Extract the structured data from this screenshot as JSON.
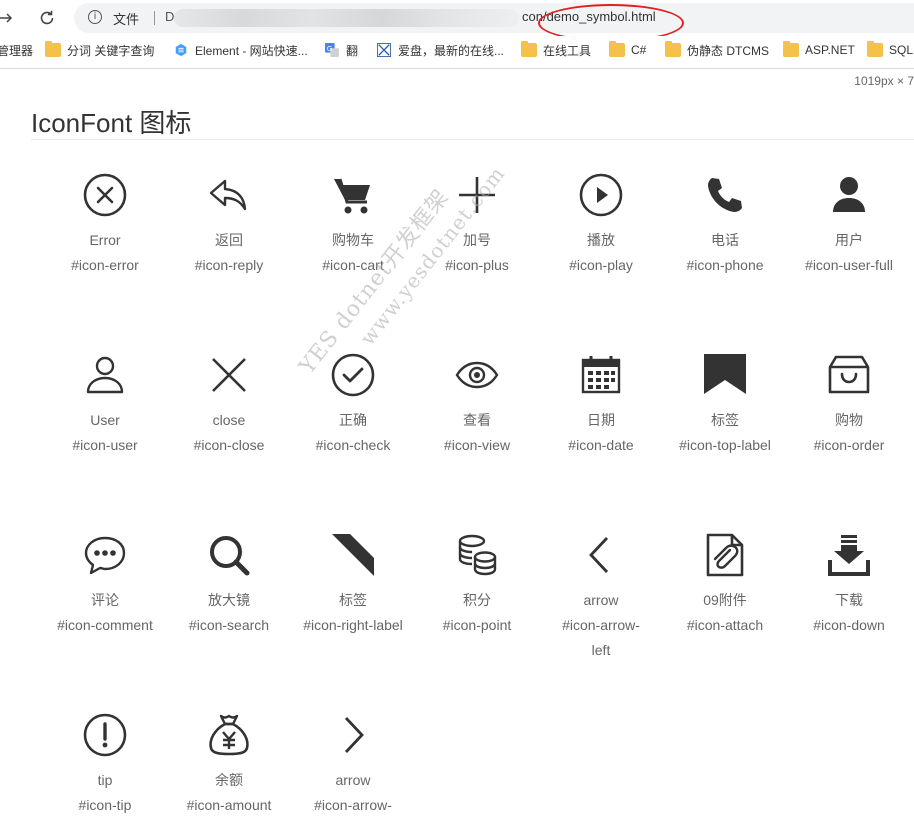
{
  "browser": {
    "file_label": "文件",
    "url_start": "D",
    "url_end": "con/demo_symbol.html",
    "bookmarks": [
      {
        "label": "管理器",
        "icon": "none"
      },
      {
        "label": "分词 关键字查询",
        "icon": "folder-icon"
      },
      {
        "label": "Element - 网站快速...",
        "icon": "element-icon"
      },
      {
        "label": "翻",
        "icon": "translate-icon"
      },
      {
        "label": "爱盘，最新的在线...",
        "icon": "picture-icon"
      },
      {
        "label": "在线工具",
        "icon": "folder-icon"
      },
      {
        "label": "C#",
        "icon": "folder-icon"
      },
      {
        "label": "伪静态 DTCMS",
        "icon": "folder-icon"
      },
      {
        "label": "ASP.NET",
        "icon": "folder-icon"
      },
      {
        "label": "SQL",
        "icon": "folder-icon"
      }
    ]
  },
  "page": {
    "size_tip": "1019px × 7",
    "title": "IconFont 图标"
  },
  "icons": [
    {
      "name": "Error",
      "code": "#icon-error"
    },
    {
      "name": "返回",
      "code": "#icon-reply"
    },
    {
      "name": "购物车",
      "code": "#icon-cart"
    },
    {
      "name": "加号",
      "code": "#icon-plus"
    },
    {
      "name": "播放",
      "code": "#icon-play"
    },
    {
      "name": "电话",
      "code": "#icon-phone"
    },
    {
      "name": "用户",
      "code": "#icon-user-full"
    },
    {
      "name": "User",
      "code": "#icon-user"
    },
    {
      "name": "close",
      "code": "#icon-close"
    },
    {
      "name": "正确",
      "code": "#icon-check"
    },
    {
      "name": "查看",
      "code": "#icon-view"
    },
    {
      "name": "日期",
      "code": "#icon-date"
    },
    {
      "name": "标签",
      "code": "#icon-top-label"
    },
    {
      "name": "购物",
      "code": "#icon-order"
    },
    {
      "name": "评论",
      "code": "#icon-comment"
    },
    {
      "name": "放大镜",
      "code": "#icon-search"
    },
    {
      "name": "标签",
      "code": "#icon-right-label"
    },
    {
      "name": "积分",
      "code": "#icon-point"
    },
    {
      "name": "arrow",
      "code": "#icon-arrow-left"
    },
    {
      "name": "09附件",
      "code": "#icon-attach"
    },
    {
      "name": "下载",
      "code": "#icon-down"
    },
    {
      "name": "tip",
      "code": "#icon-tip"
    },
    {
      "name": "余额",
      "code": "#icon-amount"
    },
    {
      "name": "arrow",
      "code": "#icon-arrow-"
    }
  ],
  "watermark": {
    "line1": "YES dotnet开发框架",
    "line2": "www.yesdotnet.com"
  }
}
